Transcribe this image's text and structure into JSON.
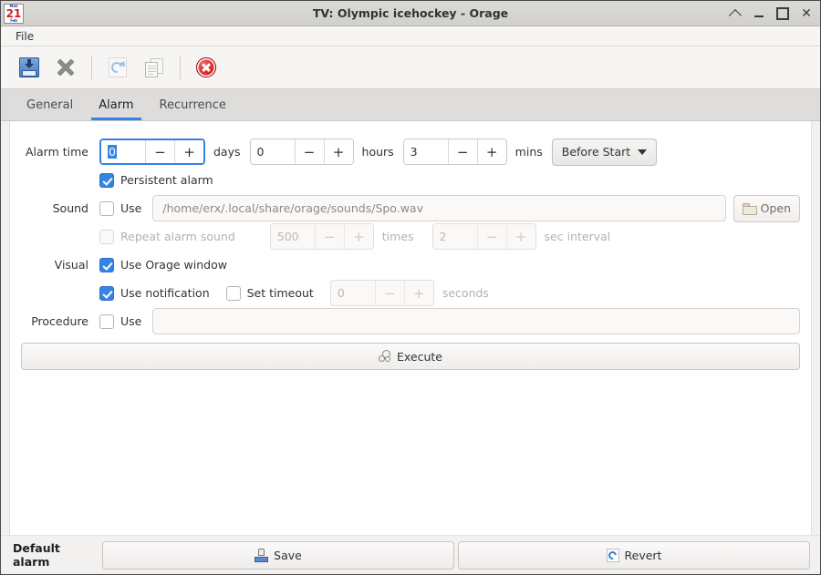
{
  "window": {
    "title": "TV: Olympic icehockey - Orage",
    "app_icon": {
      "name": "calendar-icon",
      "top_text": "Mon",
      "day": "21",
      "bottom_text": "Feb"
    },
    "controls": [
      {
        "name": "shade-button",
        "glyph": "^"
      },
      {
        "name": "minimize-button",
        "glyph": "_"
      },
      {
        "name": "maximize-button",
        "glyph": "□"
      },
      {
        "name": "close-button",
        "glyph": "✕"
      }
    ]
  },
  "menubar": {
    "items": [
      {
        "label": "File"
      }
    ]
  },
  "toolbar": {
    "buttons": [
      {
        "name": "save-button",
        "icon": "save-icon",
        "enabled": true
      },
      {
        "name": "delete-button",
        "icon": "delete-x-icon",
        "enabled": true
      },
      {
        "name": "revert-button",
        "icon": "revert-icon",
        "enabled": false
      },
      {
        "name": "duplicate-button",
        "icon": "duplicate-icon",
        "enabled": false
      },
      {
        "name": "close-window-button",
        "icon": "close-circle-icon",
        "enabled": true
      }
    ]
  },
  "tabs": [
    {
      "label": "General",
      "active": false
    },
    {
      "label": "Alarm",
      "active": true
    },
    {
      "label": "Recurrence",
      "active": false
    }
  ],
  "form": {
    "alarm_time": {
      "label": "Alarm time",
      "days": {
        "value": "0",
        "unit": "days",
        "focused": true,
        "selected": true
      },
      "hours": {
        "value": "0",
        "unit": "hours",
        "focused": false
      },
      "mins": {
        "value": "3",
        "unit": "mins",
        "focused": false
      },
      "relation": "Before Start"
    },
    "persistent_alarm": {
      "label": "Persistent alarm",
      "checked": true
    },
    "sound": {
      "label": "Sound",
      "use_label": "Use",
      "use_checked": false,
      "path": "/home/erx/.local/share/orage/sounds/Spo.wav",
      "open_label": "Open",
      "repeat_label": "Repeat alarm sound",
      "repeat_checked": false,
      "repeat_count": "500",
      "times_label": "times",
      "interval": "2",
      "interval_label": "sec interval"
    },
    "visual": {
      "label": "Visual",
      "use_orage_window": {
        "label": "Use Orage window",
        "checked": true
      },
      "use_notification": {
        "label": "Use notification",
        "checked": true
      },
      "set_timeout": {
        "label": "Set timeout",
        "checked": false
      },
      "timeout_value": "0",
      "seconds_label": "seconds"
    },
    "procedure": {
      "label": "Procedure",
      "use_label": "Use",
      "use_checked": false,
      "command": ""
    },
    "execute_label": "Execute"
  },
  "bottom": {
    "default_alarm_label": "Default alarm",
    "save_label": "Save",
    "revert_label": "Revert"
  },
  "colors": {
    "accent": "#3584e4",
    "titlebar": "#d6d4d0",
    "window_bg": "#f2f1f0",
    "content_bg": "#ffffff",
    "close_red": "#d81f1f"
  }
}
